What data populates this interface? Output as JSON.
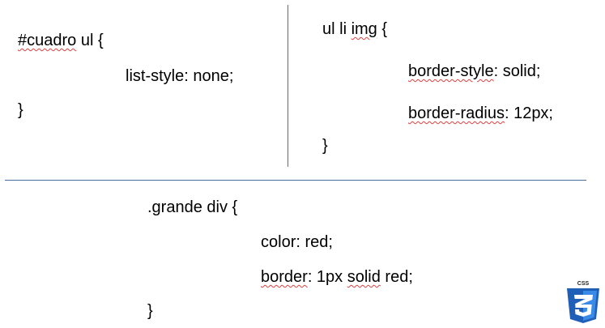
{
  "block1": {
    "selector_a": "#cuadro",
    "selector_b": "ul",
    "brace_open": "{",
    "prop": "list-style: none;",
    "brace_close": "}"
  },
  "block2": {
    "selector_a": "ul li",
    "selector_b": "img",
    "brace_open": "{",
    "prop1_name": "border-style",
    "prop1_value": ": solid;",
    "prop2_name": "border-radius",
    "prop2_value": ":  12px;",
    "brace_close": "}"
  },
  "block3": {
    "selector": ".grande div {",
    "prop1": "color: red;",
    "prop2_name": "border",
    "prop2_mid": ":  1px  ",
    "prop2_solid": "solid",
    "prop2_end": " red;",
    "brace_close": "}"
  },
  "logo": {
    "label": "CSS",
    "icon": "css3-shield-icon",
    "color": "#2a6fd6"
  },
  "colors": {
    "divider": "#4a6f9f",
    "spellcheck": "#e04040"
  }
}
